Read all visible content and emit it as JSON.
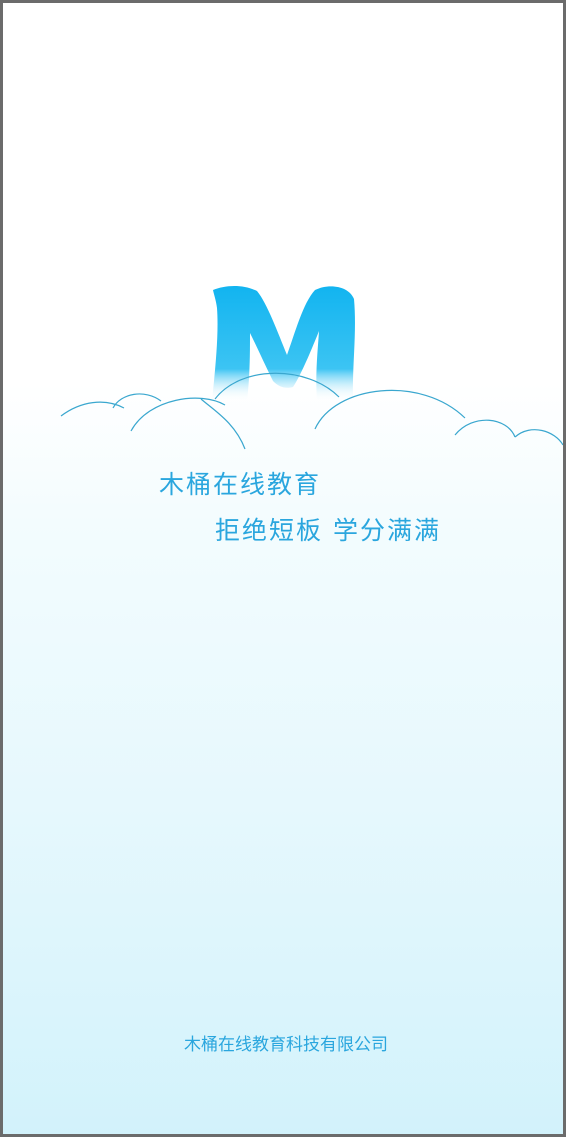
{
  "splash": {
    "logo_letter": "M",
    "slogan_line1": "木桶在线教育",
    "slogan_line2": "拒绝短板 学分满满",
    "company_name": "木桶在线教育科技有限公司"
  },
  "colors": {
    "brand_blue": "#17b6ef",
    "text_blue": "#2aa6de",
    "cloud_outline": "#3aa7cf",
    "background_bottom": "#d2f2fb"
  }
}
